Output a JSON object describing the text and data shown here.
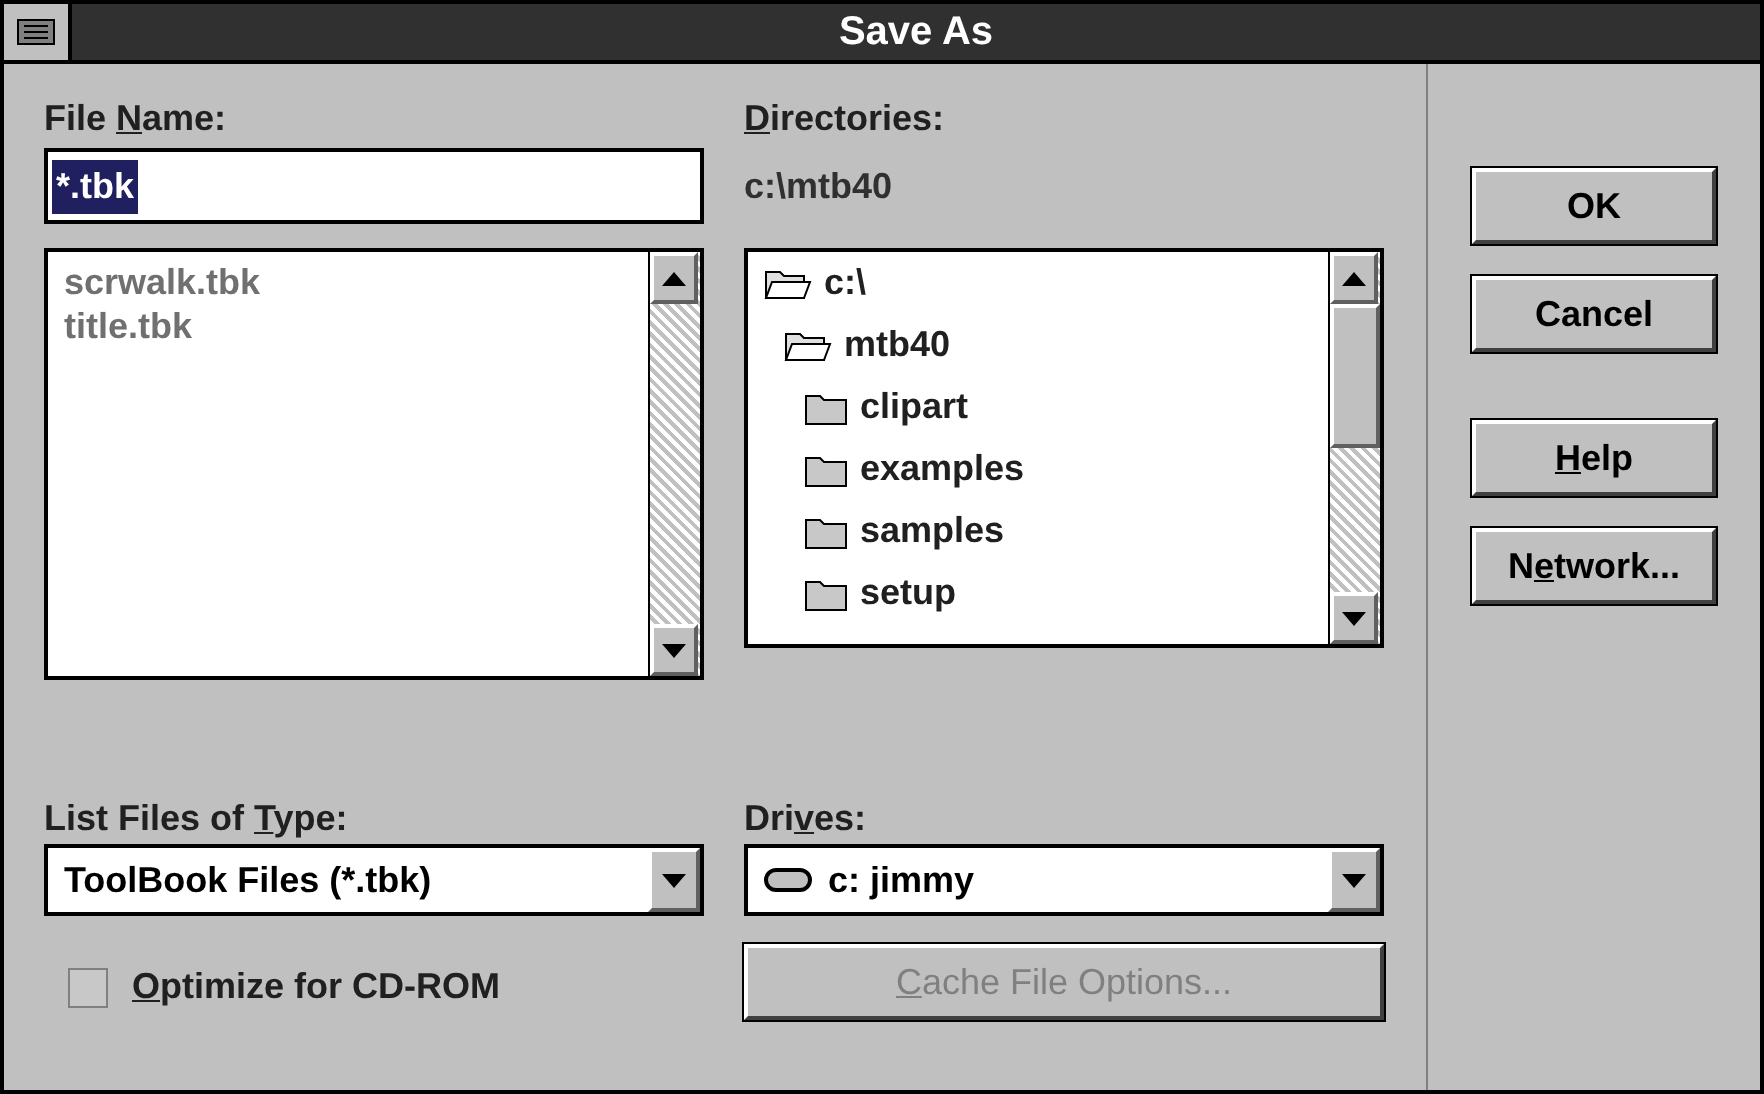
{
  "window": {
    "title": "Save As"
  },
  "file_name": {
    "label": {
      "pre": "File ",
      "key": "N",
      "post": "ame:"
    },
    "value": "*.tbk",
    "selected": true
  },
  "files": [
    {
      "name": "scrwalk.tbk"
    },
    {
      "name": "title.tbk"
    }
  ],
  "directories": {
    "label": {
      "key": "D",
      "post": "irectories:"
    },
    "path": "c:\\mtb40",
    "tree": [
      {
        "name": "c:\\",
        "expanded": true,
        "children": [
          {
            "name": "mtb40",
            "expanded": true,
            "children": [
              {
                "name": "clipart",
                "expanded": false
              },
              {
                "name": "examples",
                "expanded": false
              },
              {
                "name": "samples",
                "expanded": false
              },
              {
                "name": "setup",
                "expanded": false
              }
            ]
          }
        ]
      }
    ]
  },
  "file_type": {
    "label": {
      "pre": "List Files of ",
      "key": "T",
      "post": "ype:"
    },
    "value": "ToolBook Files (*.tbk)"
  },
  "drives": {
    "label": {
      "pre": "Dri",
      "key": "v",
      "post": "es:"
    },
    "value": "c: jimmy"
  },
  "optimize": {
    "label": {
      "key": "O",
      "post": "ptimize for CD-ROM"
    },
    "checked": false
  },
  "cache_button": {
    "label": {
      "key": "C",
      "post": "ache File Options..."
    },
    "disabled": true
  },
  "buttons": [
    {
      "label": {
        "post": "OK"
      }
    },
    {
      "label": {
        "post": "Cancel"
      }
    },
    {
      "label": {
        "key": "H",
        "post": "elp"
      }
    },
    {
      "label": {
        "pre": "N",
        "key": "e",
        "post": "twork..."
      }
    }
  ]
}
